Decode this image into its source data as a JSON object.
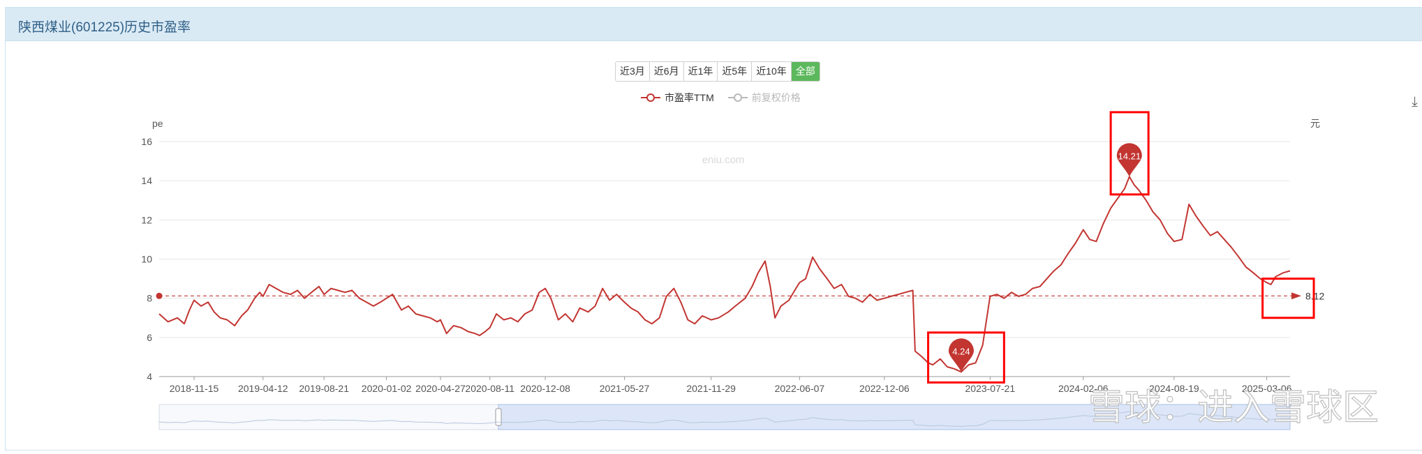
{
  "panel": {
    "title": "陕西煤业(601225)历史市盈率"
  },
  "range_buttons": [
    "近3月",
    "近6月",
    "近1年",
    "近5年",
    "近10年",
    "全部"
  ],
  "range_active": "全部",
  "legend": [
    {
      "label": "市盈率TTM",
      "active": true,
      "color": "#c23531"
    },
    {
      "label": "前复权价格",
      "active": false,
      "color": "#b8b8b8"
    }
  ],
  "watermark_site": "eniu.com",
  "watermark_brand": "雪球：进入雪球区",
  "download_icon": "download-icon",
  "chart_data": {
    "type": "line",
    "y_axis_left_label": "pe",
    "y_axis_right_label": "元",
    "ylim": [
      4,
      16
    ],
    "yticks": [
      4,
      6,
      8,
      10,
      12,
      14,
      16
    ],
    "xlim": [
      "2018-09-01",
      "2025-04-25"
    ],
    "xticks": [
      "2018-11-15",
      "2019-04-12",
      "2019-08-21",
      "2020-01-02",
      "2020-04-27",
      "2020-08-11",
      "2020-12-08",
      "2021-05-27",
      "2021-11-29",
      "2022-06-07",
      "2022-12-06",
      "2023-07-21",
      "2024-02-06",
      "2024-08-19",
      "2025-03-06"
    ],
    "series": [
      {
        "name": "市盈率TTM",
        "color": "#c23531",
        "points": [
          [
            "2018-09-01",
            7.2
          ],
          [
            "2018-09-20",
            6.8
          ],
          [
            "2018-10-10",
            7.0
          ],
          [
            "2018-10-25",
            6.7
          ],
          [
            "2018-11-05",
            7.4
          ],
          [
            "2018-11-15",
            7.9
          ],
          [
            "2018-11-30",
            7.6
          ],
          [
            "2018-12-15",
            7.8
          ],
          [
            "2018-12-28",
            7.3
          ],
          [
            "2019-01-10",
            7.0
          ],
          [
            "2019-01-25",
            6.9
          ],
          [
            "2019-02-10",
            6.6
          ],
          [
            "2019-02-25",
            7.1
          ],
          [
            "2019-03-10",
            7.4
          ],
          [
            "2019-03-25",
            8.0
          ],
          [
            "2019-04-05",
            8.3
          ],
          [
            "2019-04-12",
            8.1
          ],
          [
            "2019-04-25",
            8.7
          ],
          [
            "2019-05-10",
            8.5
          ],
          [
            "2019-05-25",
            8.3
          ],
          [
            "2019-06-10",
            8.2
          ],
          [
            "2019-06-25",
            8.4
          ],
          [
            "2019-07-10",
            8.0
          ],
          [
            "2019-07-25",
            8.3
          ],
          [
            "2019-08-10",
            8.6
          ],
          [
            "2019-08-21",
            8.2
          ],
          [
            "2019-09-05",
            8.5
          ],
          [
            "2019-09-20",
            8.4
          ],
          [
            "2019-10-05",
            8.3
          ],
          [
            "2019-10-20",
            8.4
          ],
          [
            "2019-11-05",
            8.0
          ],
          [
            "2019-11-20",
            7.8
          ],
          [
            "2019-12-05",
            7.6
          ],
          [
            "2019-12-20",
            7.8
          ],
          [
            "2020-01-02",
            8.0
          ],
          [
            "2020-01-15",
            8.2
          ],
          [
            "2020-02-03",
            7.4
          ],
          [
            "2020-02-18",
            7.6
          ],
          [
            "2020-03-05",
            7.2
          ],
          [
            "2020-03-20",
            7.1
          ],
          [
            "2020-04-05",
            7.0
          ],
          [
            "2020-04-20",
            6.8
          ],
          [
            "2020-04-27",
            6.9
          ],
          [
            "2020-05-10",
            6.2
          ],
          [
            "2020-05-25",
            6.6
          ],
          [
            "2020-06-10",
            6.5
          ],
          [
            "2020-06-25",
            6.3
          ],
          [
            "2020-07-10",
            6.2
          ],
          [
            "2020-07-20",
            6.1
          ],
          [
            "2020-08-01",
            6.3
          ],
          [
            "2020-08-11",
            6.5
          ],
          [
            "2020-08-25",
            7.2
          ],
          [
            "2020-09-10",
            6.9
          ],
          [
            "2020-09-25",
            7.0
          ],
          [
            "2020-10-10",
            6.8
          ],
          [
            "2020-10-25",
            7.2
          ],
          [
            "2020-11-10",
            7.4
          ],
          [
            "2020-11-25",
            8.3
          ],
          [
            "2020-12-08",
            8.5
          ],
          [
            "2020-12-20",
            8.0
          ],
          [
            "2021-01-05",
            6.9
          ],
          [
            "2021-01-20",
            7.2
          ],
          [
            "2021-02-05",
            6.8
          ],
          [
            "2021-02-20",
            7.5
          ],
          [
            "2021-03-10",
            7.3
          ],
          [
            "2021-03-25",
            7.6
          ],
          [
            "2021-04-10",
            8.5
          ],
          [
            "2021-04-25",
            7.9
          ],
          [
            "2021-05-10",
            8.2
          ],
          [
            "2021-05-27",
            7.8
          ],
          [
            "2021-06-10",
            7.5
          ],
          [
            "2021-06-25",
            7.3
          ],
          [
            "2021-07-10",
            6.9
          ],
          [
            "2021-07-25",
            6.7
          ],
          [
            "2021-08-10",
            7.0
          ],
          [
            "2021-08-25",
            8.1
          ],
          [
            "2021-09-10",
            8.5
          ],
          [
            "2021-09-25",
            7.8
          ],
          [
            "2021-10-10",
            6.9
          ],
          [
            "2021-10-25",
            6.7
          ],
          [
            "2021-11-10",
            7.1
          ],
          [
            "2021-11-29",
            6.9
          ],
          [
            "2021-12-15",
            7.0
          ],
          [
            "2022-01-05",
            7.3
          ],
          [
            "2022-01-20",
            7.6
          ],
          [
            "2022-02-10",
            8.0
          ],
          [
            "2022-02-25",
            8.6
          ],
          [
            "2022-03-10",
            9.3
          ],
          [
            "2022-03-25",
            9.9
          ],
          [
            "2022-04-05",
            8.6
          ],
          [
            "2022-04-15",
            7.0
          ],
          [
            "2022-04-28",
            7.6
          ],
          [
            "2022-05-15",
            7.9
          ],
          [
            "2022-05-30",
            8.5
          ],
          [
            "2022-06-07",
            8.8
          ],
          [
            "2022-06-20",
            9.0
          ],
          [
            "2022-07-05",
            10.1
          ],
          [
            "2022-07-20",
            9.5
          ],
          [
            "2022-08-05",
            9.0
          ],
          [
            "2022-08-20",
            8.5
          ],
          [
            "2022-09-05",
            8.7
          ],
          [
            "2022-09-20",
            8.1
          ],
          [
            "2022-10-05",
            8.0
          ],
          [
            "2022-10-20",
            7.8
          ],
          [
            "2022-11-05",
            8.2
          ],
          [
            "2022-11-20",
            7.9
          ],
          [
            "2022-12-06",
            8.0
          ],
          [
            "2022-12-20",
            8.1
          ],
          [
            "2023-01-05",
            8.2
          ],
          [
            "2023-01-20",
            8.3
          ],
          [
            "2023-02-05",
            8.4
          ],
          [
            "2023-02-10",
            5.3
          ],
          [
            "2023-02-25",
            5.0
          ],
          [
            "2023-03-10",
            4.7
          ],
          [
            "2023-03-20",
            4.6
          ],
          [
            "2023-04-05",
            4.9
          ],
          [
            "2023-04-20",
            4.5
          ],
          [
            "2023-05-05",
            4.4
          ],
          [
            "2023-05-20",
            4.24
          ],
          [
            "2023-06-05",
            4.6
          ],
          [
            "2023-06-20",
            4.7
          ],
          [
            "2023-07-05",
            5.6
          ],
          [
            "2023-07-21",
            8.1
          ],
          [
            "2023-08-05",
            8.2
          ],
          [
            "2023-08-20",
            8.0
          ],
          [
            "2023-09-05",
            8.3
          ],
          [
            "2023-09-20",
            8.1
          ],
          [
            "2023-10-05",
            8.2
          ],
          [
            "2023-10-20",
            8.5
          ],
          [
            "2023-11-05",
            8.6
          ],
          [
            "2023-11-20",
            9.0
          ],
          [
            "2023-12-05",
            9.4
          ],
          [
            "2023-12-20",
            9.7
          ],
          [
            "2024-01-05",
            10.3
          ],
          [
            "2024-01-20",
            10.8
          ],
          [
            "2024-02-06",
            11.5
          ],
          [
            "2024-02-20",
            11.0
          ],
          [
            "2024-03-05",
            10.9
          ],
          [
            "2024-03-20",
            11.8
          ],
          [
            "2024-04-05",
            12.6
          ],
          [
            "2024-04-20",
            13.1
          ],
          [
            "2024-05-05",
            13.6
          ],
          [
            "2024-05-15",
            14.21
          ],
          [
            "2024-05-25",
            13.8
          ],
          [
            "2024-06-05",
            13.5
          ],
          [
            "2024-06-20",
            13.0
          ],
          [
            "2024-07-05",
            12.4
          ],
          [
            "2024-07-20",
            12.0
          ],
          [
            "2024-08-05",
            11.3
          ],
          [
            "2024-08-19",
            10.9
          ],
          [
            "2024-09-05",
            11.0
          ],
          [
            "2024-09-20",
            12.8
          ],
          [
            "2024-10-05",
            12.2
          ],
          [
            "2024-10-20",
            11.7
          ],
          [
            "2024-11-05",
            11.2
          ],
          [
            "2024-11-20",
            11.4
          ],
          [
            "2024-12-05",
            11.0
          ],
          [
            "2024-12-20",
            10.6
          ],
          [
            "2025-01-05",
            10.1
          ],
          [
            "2025-01-20",
            9.6
          ],
          [
            "2025-02-05",
            9.3
          ],
          [
            "2025-02-20",
            9.0
          ],
          [
            "2025-03-06",
            8.8
          ],
          [
            "2025-03-15",
            8.7
          ],
          [
            "2025-03-25",
            9.1
          ],
          [
            "2025-04-10",
            9.3
          ],
          [
            "2025-04-25",
            9.4
          ]
        ]
      }
    ],
    "markline": {
      "value": 8.12,
      "label": "8.12"
    },
    "markpoints": [
      {
        "date": "2024-05-15",
        "value": 14.21,
        "label": "14.21"
      },
      {
        "date": "2023-05-20",
        "value": 4.24,
        "label": "4.24"
      }
    ],
    "highlight_boxes": [
      {
        "date_from": "2024-04-05",
        "date_to": "2024-06-25",
        "y_from": 13.3,
        "y_to": 17.5
      },
      {
        "date_from": "2023-03-10",
        "date_to": "2023-08-20",
        "y_from": 3.7,
        "y_to": 6.25
      },
      {
        "date_from": "2025-02-25",
        "date_to": "2025-06-15",
        "y_from": 7.0,
        "y_to": 9.0
      }
    ]
  },
  "data_zoom": {
    "start_fraction": 0.3,
    "end_fraction": 1.0
  }
}
